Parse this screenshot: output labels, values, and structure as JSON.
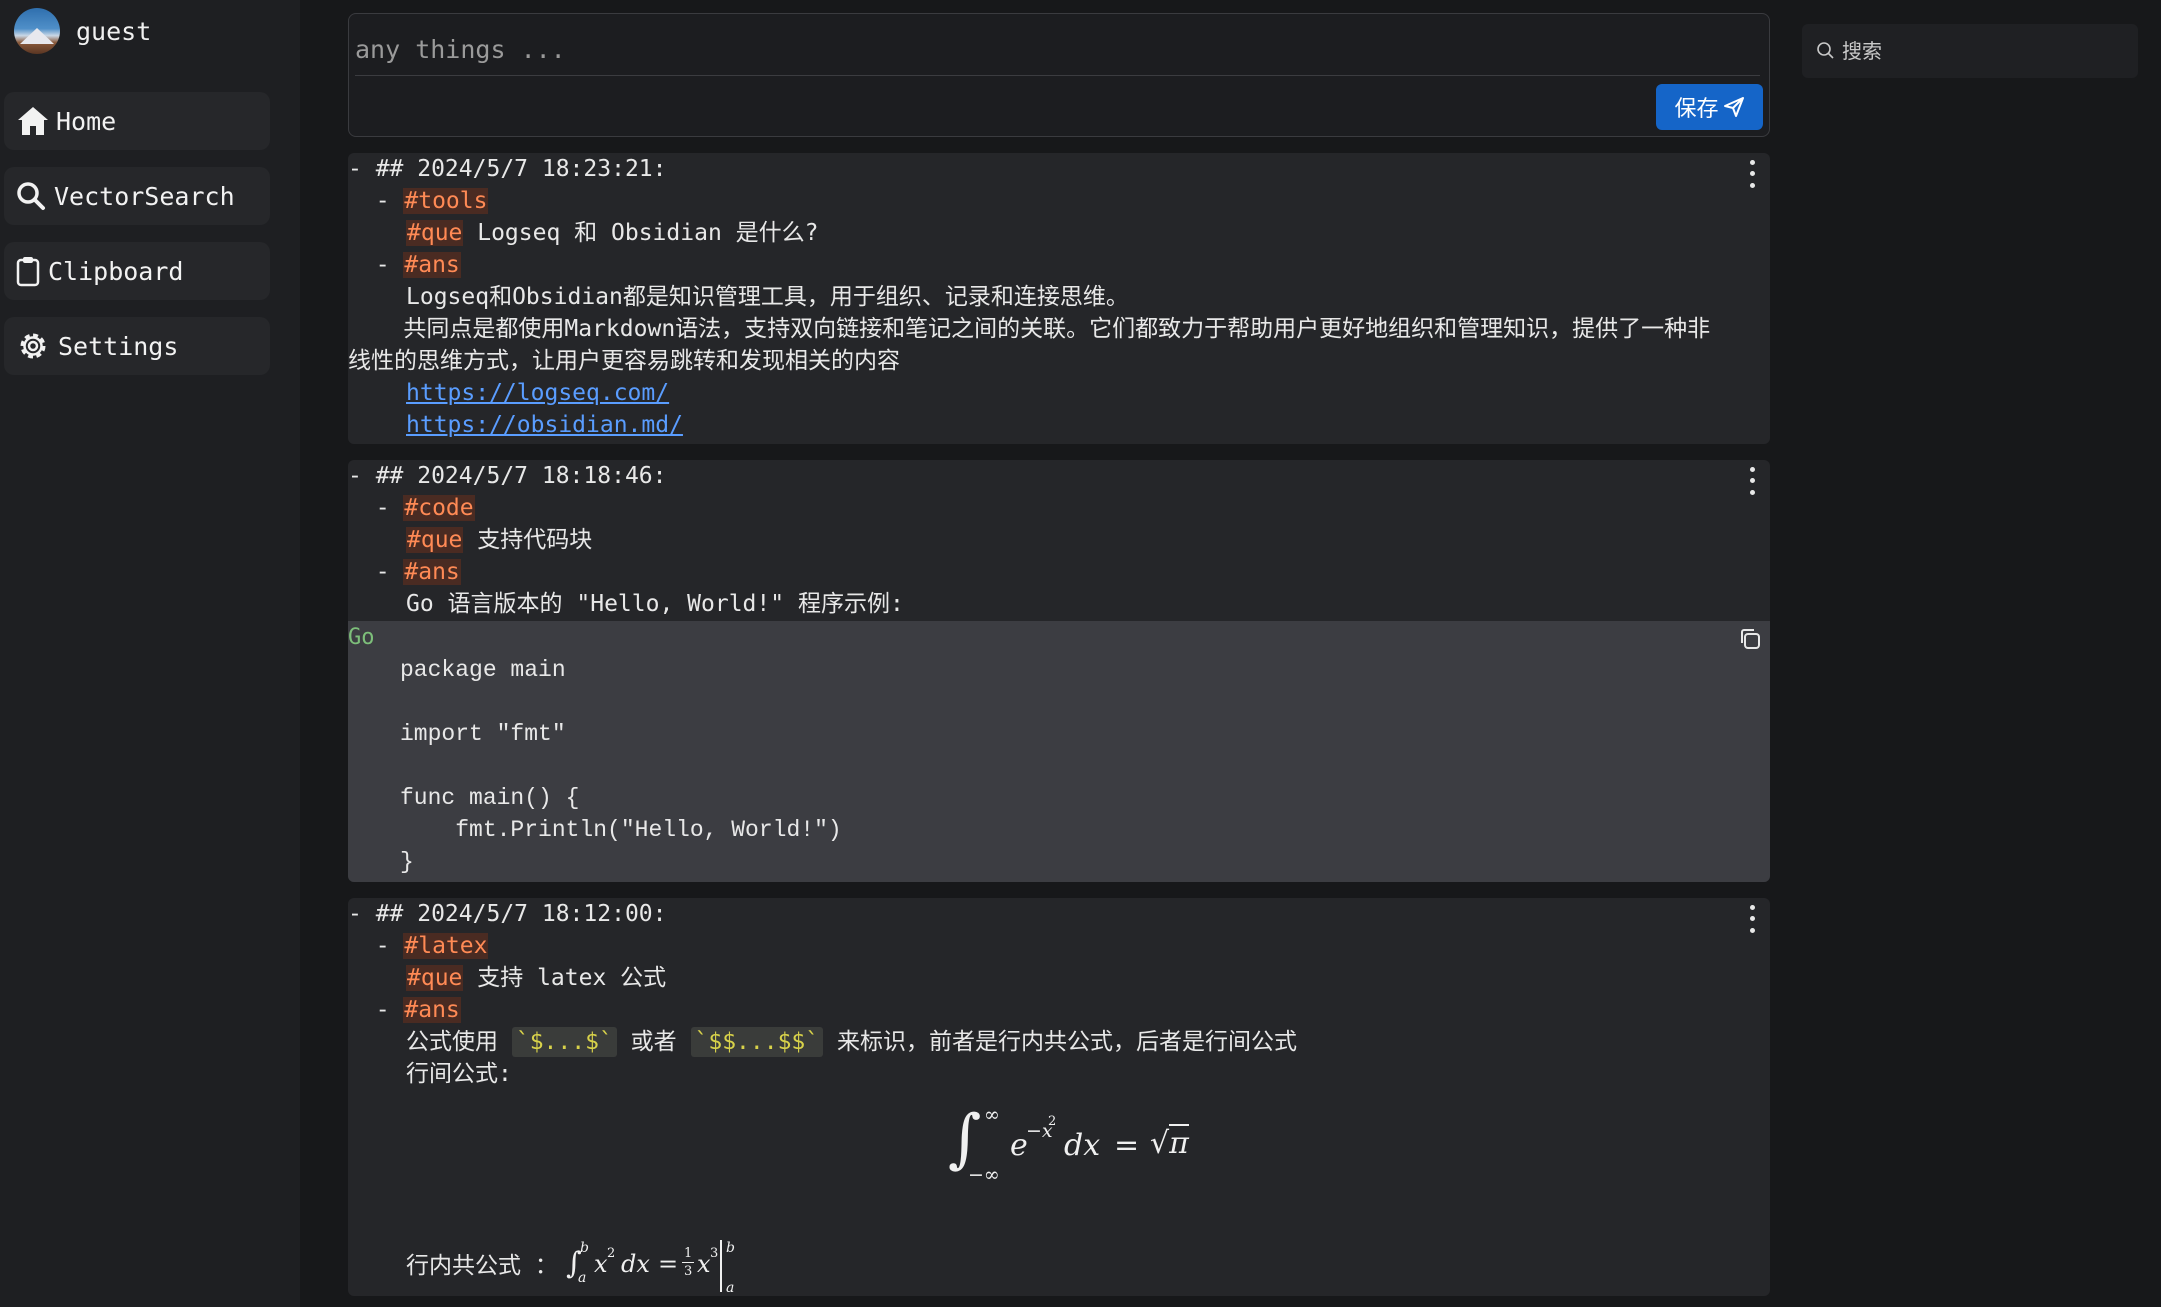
{
  "user": {
    "name": "guest"
  },
  "nav": [
    {
      "label": "Home",
      "icon": "home-icon"
    },
    {
      "label": "VectorSearch",
      "icon": "search-icon"
    },
    {
      "label": "Clipboard",
      "icon": "clipboard-icon"
    },
    {
      "label": "Settings",
      "icon": "gear-icon"
    }
  ],
  "editor": {
    "placeholder": "any things ...",
    "save_label": "保存"
  },
  "search": {
    "placeholder": "搜索"
  },
  "colors": {
    "accent": "#1565c8",
    "tag": "#ff8a55",
    "link": "#5a9dff",
    "code_lang": "#7dbf7a"
  },
  "notes": [
    {
      "heading": "- ## 2024/5/7 18:23:21:",
      "topic_prefix": "  - ",
      "topic_tag": "#tools",
      "que_tag": "#que",
      "question": " Logseq 和 Obsidian 是什么?",
      "ans_prefix": "  - ",
      "ans_tag": "#ans",
      "answer_line1": "Logseq和Obsidian都是知识管理工具，用于组织、记录和连接思维。",
      "answer_line2a": "    共同点是都使用Markdown语法，支持双向链接和笔记之间的关联。它们都致力于帮助用户更好地组织和管理知识，提供了一种非",
      "answer_line2b": "线性的思维方式，让用户更容易跳转和发现相关的内容",
      "link1": "https://logseq.com/",
      "link2": "https://obsidian.md/"
    },
    {
      "heading": "- ## 2024/5/7 18:18:46:",
      "topic_prefix": "  - ",
      "topic_tag": "#code",
      "que_tag": "#que",
      "question": " 支持代码块",
      "ans_prefix": "  - ",
      "ans_tag": "#ans",
      "answer_line1": "Go 语言版本的 \"Hello, World!\" 程序示例:",
      "code_lang": "Go",
      "code": [
        "package main",
        "",
        "import \"fmt\"",
        "",
        "func main() {",
        "    fmt.Println(\"Hello, World!\")",
        "}"
      ]
    },
    {
      "heading": "- ## 2024/5/7 18:12:00:",
      "topic_prefix": "  - ",
      "topic_tag": "#latex",
      "que_tag": "#que",
      "question": " 支持 latex 公式",
      "ans_prefix": "  - ",
      "ans_tag": "#ans",
      "answer_pre": "公式使用 ",
      "inline_code1": "`$...$`",
      "answer_mid": " 或者 ",
      "inline_code2": "`$$...$$`",
      "answer_post": " 来标识，前者是行内共公式，后者是行间公式",
      "block_label": "行间公式:",
      "inline_label": "行内共公式 ："
    }
  ]
}
